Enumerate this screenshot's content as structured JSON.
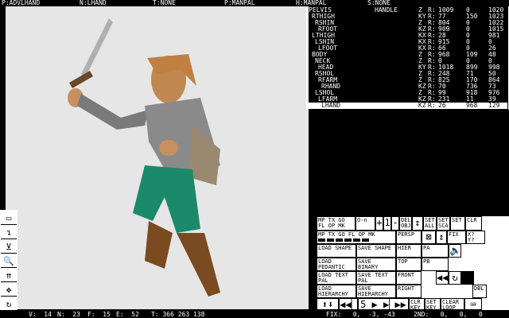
{
  "topbar": {
    "p": "P:ADVLHAND",
    "n": "N:LHAND",
    "t": "T:NONE",
    "p2": "P:MANPAL",
    "h": "H:MANPAL",
    "s": "S:NONE"
  },
  "bones": [
    {
      "name": "PELVIS",
      "extra": "HANDLE",
      "axis": "Z",
      "r": "R:",
      "a": "1009",
      "b": "0",
      "c": "1020"
    },
    {
      "name": "RTHIGH",
      "axis": "KY",
      "r": "R:",
      "a": "77",
      "b": "150",
      "c": "1023"
    },
    {
      "name": "RSHIN",
      "axis": "Z",
      "r": "R:",
      "a": "804",
      "b": "0",
      "c": "1022"
    },
    {
      "name": "RFOOT",
      "axis": "KZ",
      "r": "R:",
      "a": "909",
      "b": "0",
      "c": "1015"
    },
    {
      "name": "LTHIGH",
      "axis": "KX",
      "r": "R:",
      "a": "28",
      "b": "0",
      "c": "981"
    },
    {
      "name": "LSHIN",
      "axis": "KX",
      "r": "R:",
      "a": "915",
      "b": "0",
      "c": "0"
    },
    {
      "name": "LFOOT",
      "axis": "KX",
      "r": "R:",
      "a": "66",
      "b": "0",
      "c": "26"
    },
    {
      "name": "BODY",
      "axis": "Z",
      "r": "R:",
      "a": "968",
      "b": "109",
      "c": "48"
    },
    {
      "name": "NECK",
      "axis": "Z",
      "r": "R:",
      "a": "0",
      "b": "0",
      "c": "0"
    },
    {
      "name": "HEAD",
      "axis": "KY",
      "r": "R:",
      "a": "1018",
      "b": "899",
      "c": "998"
    },
    {
      "name": "RSHOL",
      "axis": "Z",
      "r": "R:",
      "a": "248",
      "b": "71",
      "c": "50"
    },
    {
      "name": "RFARM",
      "axis": "Z",
      "r": "R:",
      "a": "825",
      "b": "170",
      "c": "864"
    },
    {
      "name": "RHAND",
      "axis": "KZ",
      "r": "R:",
      "a": "70",
      "b": "736",
      "c": "73"
    },
    {
      "name": "LSHOL",
      "axis": "Z",
      "r": "R:",
      "a": "99",
      "b": "918",
      "c": "976"
    },
    {
      "name": "LFARM",
      "axis": "KZ",
      "r": "R:",
      "a": "231",
      "b": "11",
      "c": "39"
    },
    {
      "name": "LHAND",
      "axis": "KZ",
      "r": "R:",
      "a": "26",
      "b": "968",
      "c": "129"
    }
  ],
  "buttons": {
    "flags1": "MP TX GO FL OP MK",
    "flags2": "MP TX GO FL OP MK",
    "key": "O-n",
    "plus": "+",
    "one": "1",
    "minus": "-",
    "del_obj": "DEL OBJ",
    "set_all": "SET ALL",
    "set_sca": "SET SCA",
    "set": "SET",
    "clr": "CLR",
    "persp": "PERSP",
    "fix": "FIX",
    "xy": "X? Y?",
    "hier": "HIER",
    "pa": "PA",
    "pb": "PB",
    "load_shape": "LOAD SHAPE",
    "save_shape": "SAVE SHAPE",
    "load_pedant": "LOAD PEDANTIC",
    "save_binary": "SAVE BINARY",
    "top": "TOP",
    "front": "FRONT",
    "right": "RIGHT",
    "load_text": "LOAD TEXT PAL",
    "save_text": "SAVE TEXT PAL",
    "load_hier": "LOAD HIERARCHY",
    "save_hier": "SAVE HIERARCHY",
    "dbl": "DBL",
    "frame": "5",
    "clr_key": "CLR KEY",
    "set_key": "SET KEY",
    "clear_loop": "CLEAR LOOP"
  },
  "status": {
    "v": "V:  14",
    "n": "N:  23",
    "f": "F:  15",
    "e": "E:  52",
    "t": "T: 366 263 138",
    "fix": "FIX:   0,  -3, -43",
    "end": "2ND:   0,   0,   0"
  }
}
